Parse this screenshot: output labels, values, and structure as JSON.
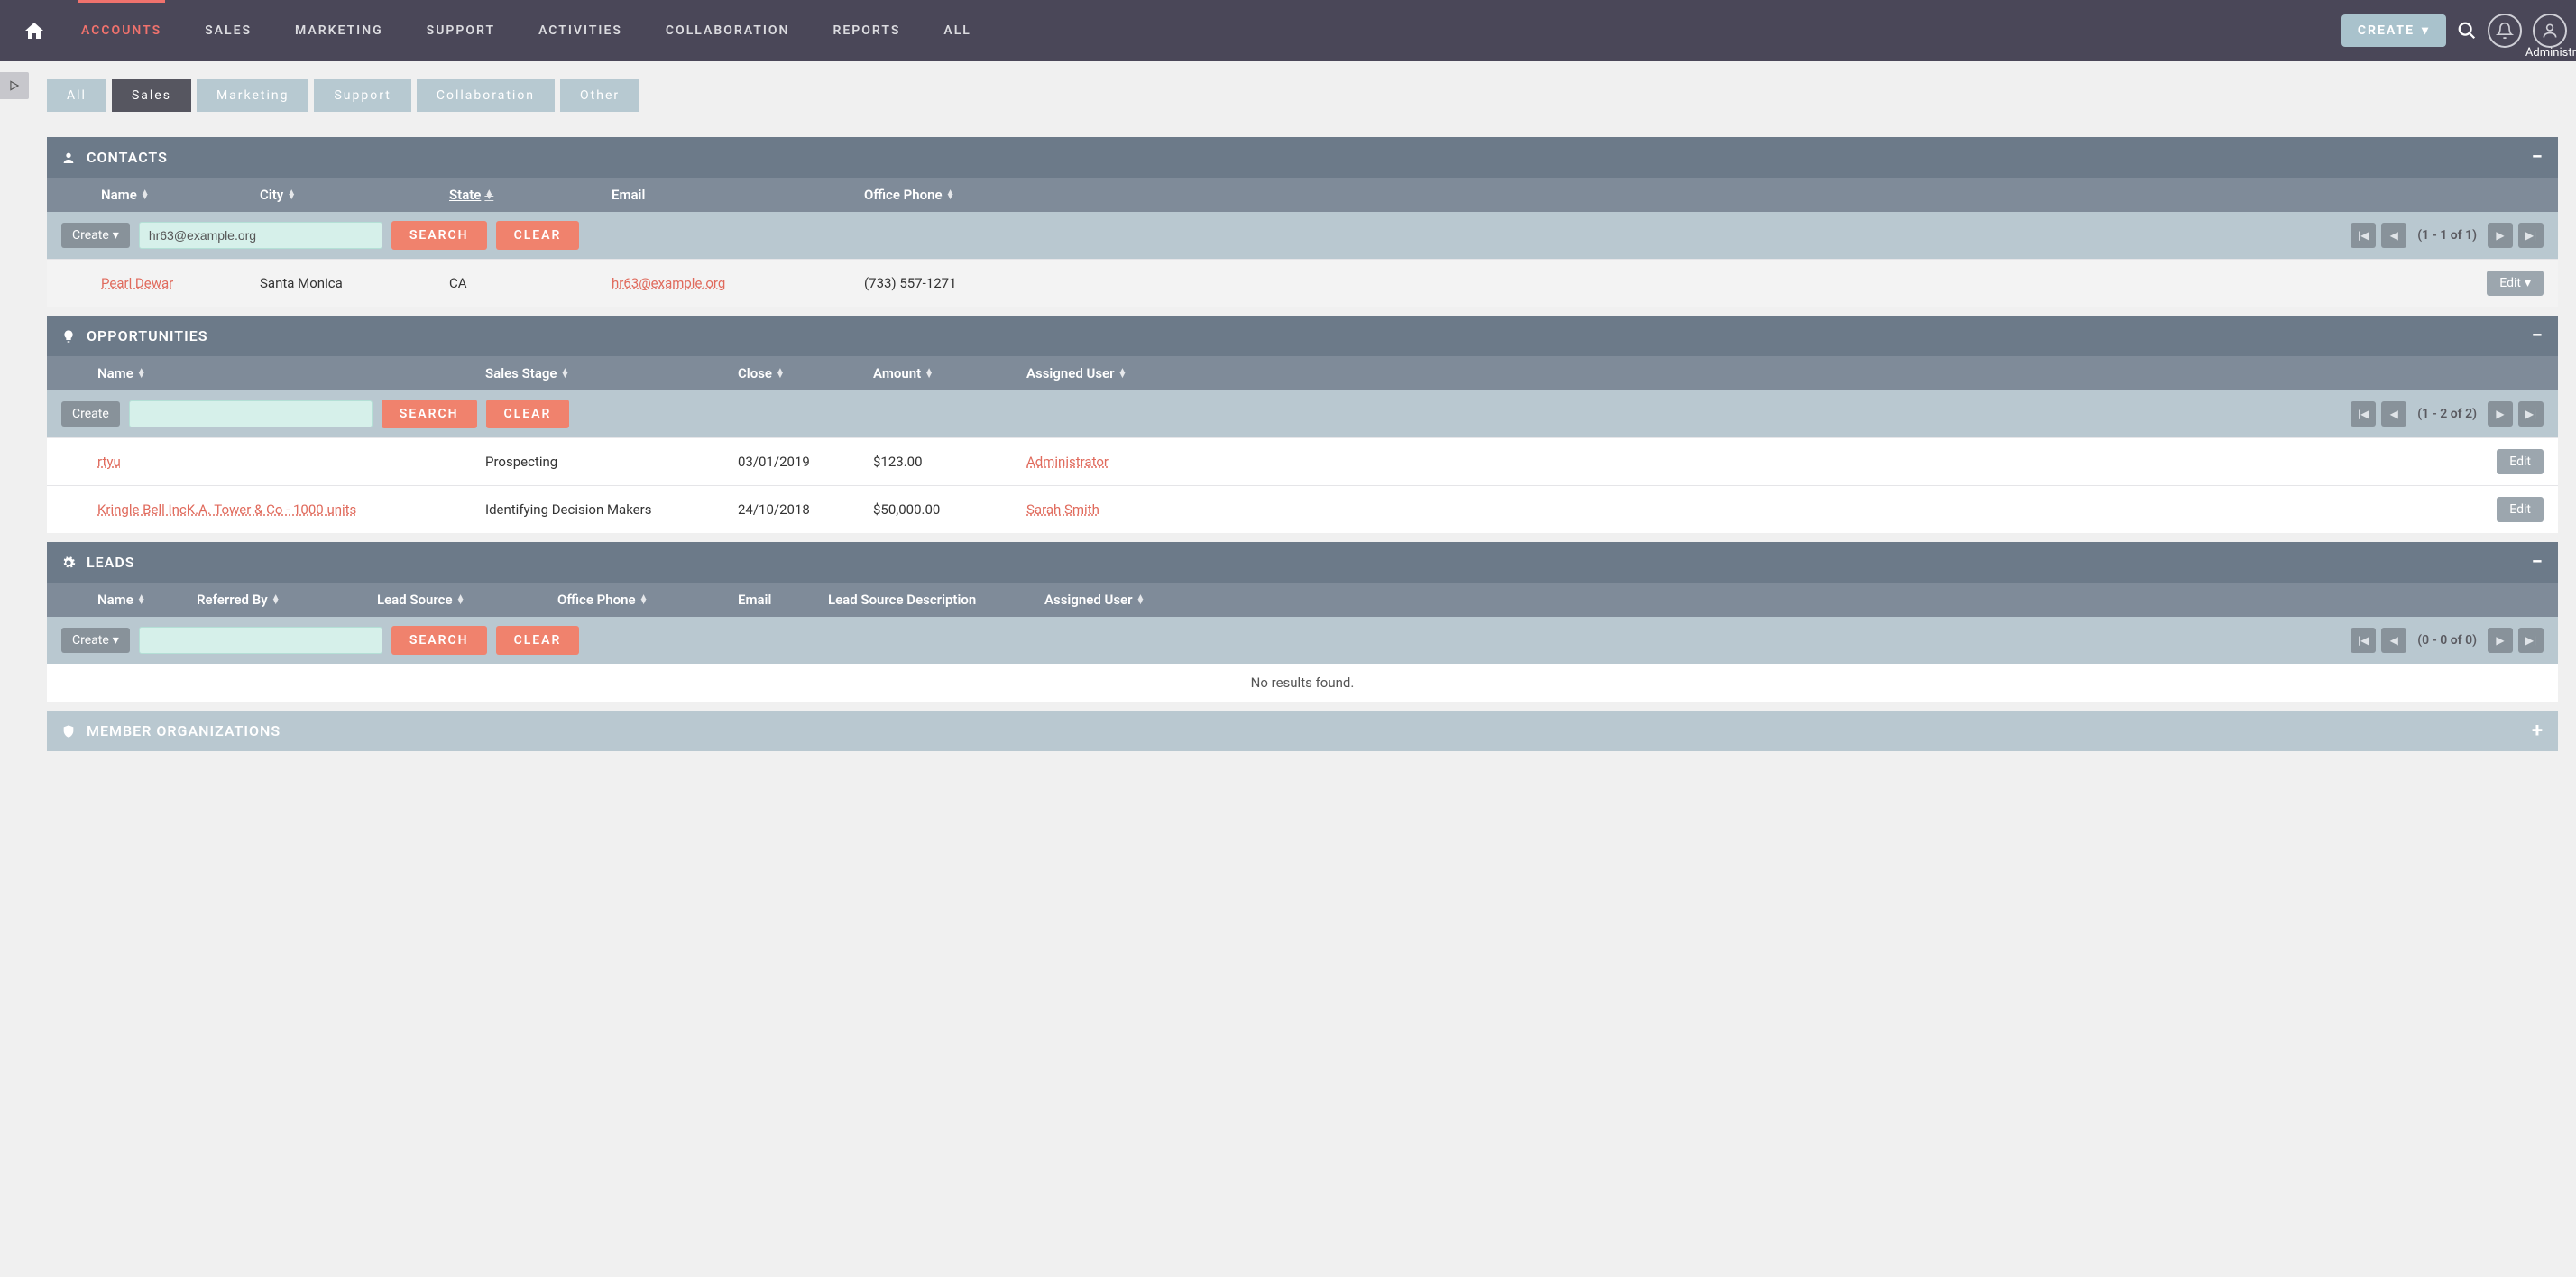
{
  "topbar": {
    "nav": [
      "ACCOUNTS",
      "SALES",
      "MARKETING",
      "SUPPORT",
      "ACTIVITIES",
      "COLLABORATION",
      "REPORTS",
      "ALL"
    ],
    "active_index": 0,
    "create_label": "CREATE",
    "admin_label": "Administr"
  },
  "subtabs": {
    "items": [
      "All",
      "Sales",
      "Marketing",
      "Support",
      "Collaboration",
      "Other"
    ],
    "active_index": 1
  },
  "buttons": {
    "search": "SEARCH",
    "clear": "CLEAR",
    "create": "Create",
    "edit": "Edit"
  },
  "contacts": {
    "title": "CONTACTS",
    "columns": [
      "Name",
      "City",
      "State",
      "Email",
      "Office Phone"
    ],
    "search_value": "hr63@example.org",
    "pager": "(1 - 1 of 1)",
    "rows": [
      {
        "name": "Pearl Dewar",
        "city": "Santa Monica",
        "state": "CA",
        "email": "hr63@example.org",
        "phone": "(733) 557-1271"
      }
    ]
  },
  "opportunities": {
    "title": "OPPORTUNITIES",
    "columns": [
      "Name",
      "Sales Stage",
      "Close",
      "Amount",
      "Assigned User"
    ],
    "search_value": "",
    "pager": "(1 - 2 of 2)",
    "rows": [
      {
        "name": "rtyu",
        "stage": "Prospecting",
        "close": "03/01/2019",
        "amount": "$123.00",
        "assigned": "Administrator"
      },
      {
        "name": "Kringle Bell IncK.A. Tower & Co - 1000 units",
        "stage": "Identifying Decision Makers",
        "close": "24/10/2018",
        "amount": "$50,000.00",
        "assigned": "Sarah Smith"
      }
    ]
  },
  "leads": {
    "title": "LEADS",
    "columns": [
      "Name",
      "Referred By",
      "Lead Source",
      "Office Phone",
      "Email",
      "Lead Source Description",
      "Assigned User"
    ],
    "search_value": "",
    "pager": "(0 - 0 of 0)",
    "no_results": "No results found."
  },
  "member_orgs": {
    "title": "MEMBER ORGANIZATIONS"
  }
}
